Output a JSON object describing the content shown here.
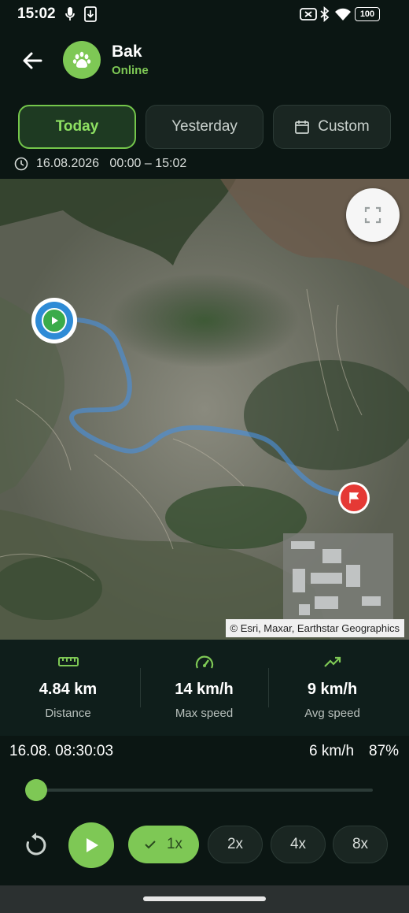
{
  "status_bar": {
    "time": "15:02",
    "battery": "100"
  },
  "header": {
    "title": "Bak",
    "status": "Online",
    "status_color": "#7ec855"
  },
  "range_tabs": [
    {
      "label": "Today",
      "selected": true
    },
    {
      "label": "Yesterday",
      "selected": false
    },
    {
      "label": "Custom",
      "selected": false
    }
  ],
  "date_range": "16.08.2026   00:00 – 15:02",
  "map": {
    "attribution": "© Esri, Maxar, Earthstar Geographics",
    "route_color": "#4a8fd8",
    "start_marker_color": "#2e8bd6",
    "end_marker_color": "#e53935"
  },
  "stats": [
    {
      "icon": "ruler-icon",
      "value": "4.84 km",
      "label": "Distance"
    },
    {
      "icon": "speedometer-icon",
      "value": "14 km/h",
      "label": "Max speed"
    },
    {
      "icon": "trending-up-icon",
      "value": "9 km/h",
      "label": "Avg speed"
    }
  ],
  "playback": {
    "timestamp": "16.08. 08:30:03",
    "speed": "6 km/h",
    "battery": "87%",
    "progress": 0,
    "speed_options": [
      {
        "label": "1x",
        "selected": true
      },
      {
        "label": "2x",
        "selected": false
      },
      {
        "label": "4x",
        "selected": false
      },
      {
        "label": "8x",
        "selected": false
      }
    ]
  },
  "colors": {
    "accent": "#7ec855",
    "background": "#0b1613",
    "panel": "#0f1e1b"
  }
}
